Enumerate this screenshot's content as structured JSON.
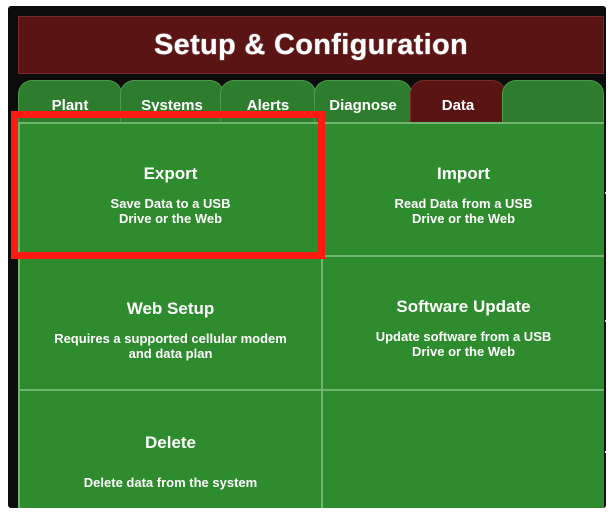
{
  "header": {
    "title": "Setup & Configuration"
  },
  "tabs": [
    {
      "label": "Plant",
      "active": false
    },
    {
      "label": "Systems",
      "active": false
    },
    {
      "label": "Alerts",
      "active": false
    },
    {
      "label": "Diagnose",
      "active": false
    },
    {
      "label": "Data",
      "active": true
    },
    {
      "label": "",
      "active": false
    }
  ],
  "tiles": {
    "export": {
      "title": "Export",
      "description": "Save Data to a USB Drive or the Web"
    },
    "import": {
      "title": "Import",
      "description": "Read Data from a USB Drive or the Web"
    },
    "web_setup": {
      "title": "Web Setup",
      "description": "Requires a supported cellular modem and data plan"
    },
    "software_update": {
      "title": "Software Update",
      "description": "Update software from a USB Drive or the Web"
    },
    "delete": {
      "title": "Delete",
      "description": "Delete data from the system"
    },
    "empty": {
      "title": "",
      "description": ""
    }
  },
  "colors": {
    "title_bar": "#5a1414",
    "tab_green": "#2e7d2e",
    "tile_green": "#2e8b2e",
    "tile_border": "#6fb56f",
    "highlight": "#ff1a12"
  }
}
